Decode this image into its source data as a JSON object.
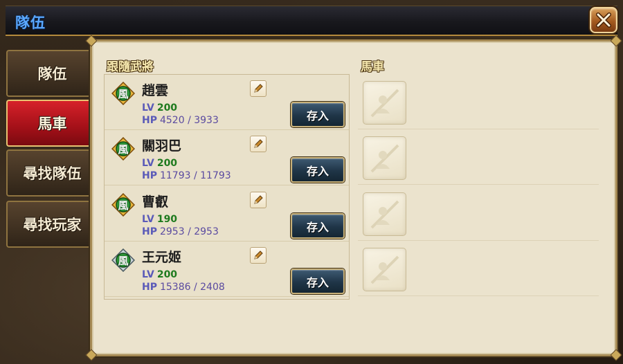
{
  "window": {
    "title": "隊伍"
  },
  "tabs": [
    {
      "label": "隊伍",
      "active": false
    },
    {
      "label": "馬車",
      "active": true
    },
    {
      "label": "尋找隊伍",
      "active": false
    },
    {
      "label": "尋找玩家",
      "active": false
    }
  ],
  "followers_section": {
    "label": "跟隨武將"
  },
  "carriage_section": {
    "label": "馬車"
  },
  "labels": {
    "lv": "LV",
    "hp": "HP",
    "store": "存入"
  },
  "followers": [
    {
      "name": "趙雲",
      "emblem": "風",
      "emblem_style": "gold",
      "level": "200",
      "hp": "4520 / 3933"
    },
    {
      "name": "關羽巴",
      "emblem": "風",
      "emblem_style": "gold",
      "level": "200",
      "hp": "11793 / 11793"
    },
    {
      "name": "曹叡",
      "emblem": "風",
      "emblem_style": "gold",
      "level": "190",
      "hp": "2953 / 2953"
    },
    {
      "name": "王元姬",
      "emblem": "風",
      "emblem_style": "silver",
      "level": "200",
      "hp": "15386 / 2408"
    }
  ],
  "carriage_slots": [
    {
      "state": "empty",
      "icon": "empty-portrait-icon"
    },
    {
      "state": "empty",
      "icon": "empty-portrait-icon"
    },
    {
      "state": "empty",
      "icon": "empty-portrait-icon"
    },
    {
      "state": "empty",
      "icon": "empty-portrait-icon"
    }
  ],
  "colors": {
    "active_tab": "#c0161f",
    "title_text": "#5aa8ff",
    "store_button": "#1f3547",
    "level_text": "#1e7a1e",
    "hp_text": "#5a4aa0"
  }
}
